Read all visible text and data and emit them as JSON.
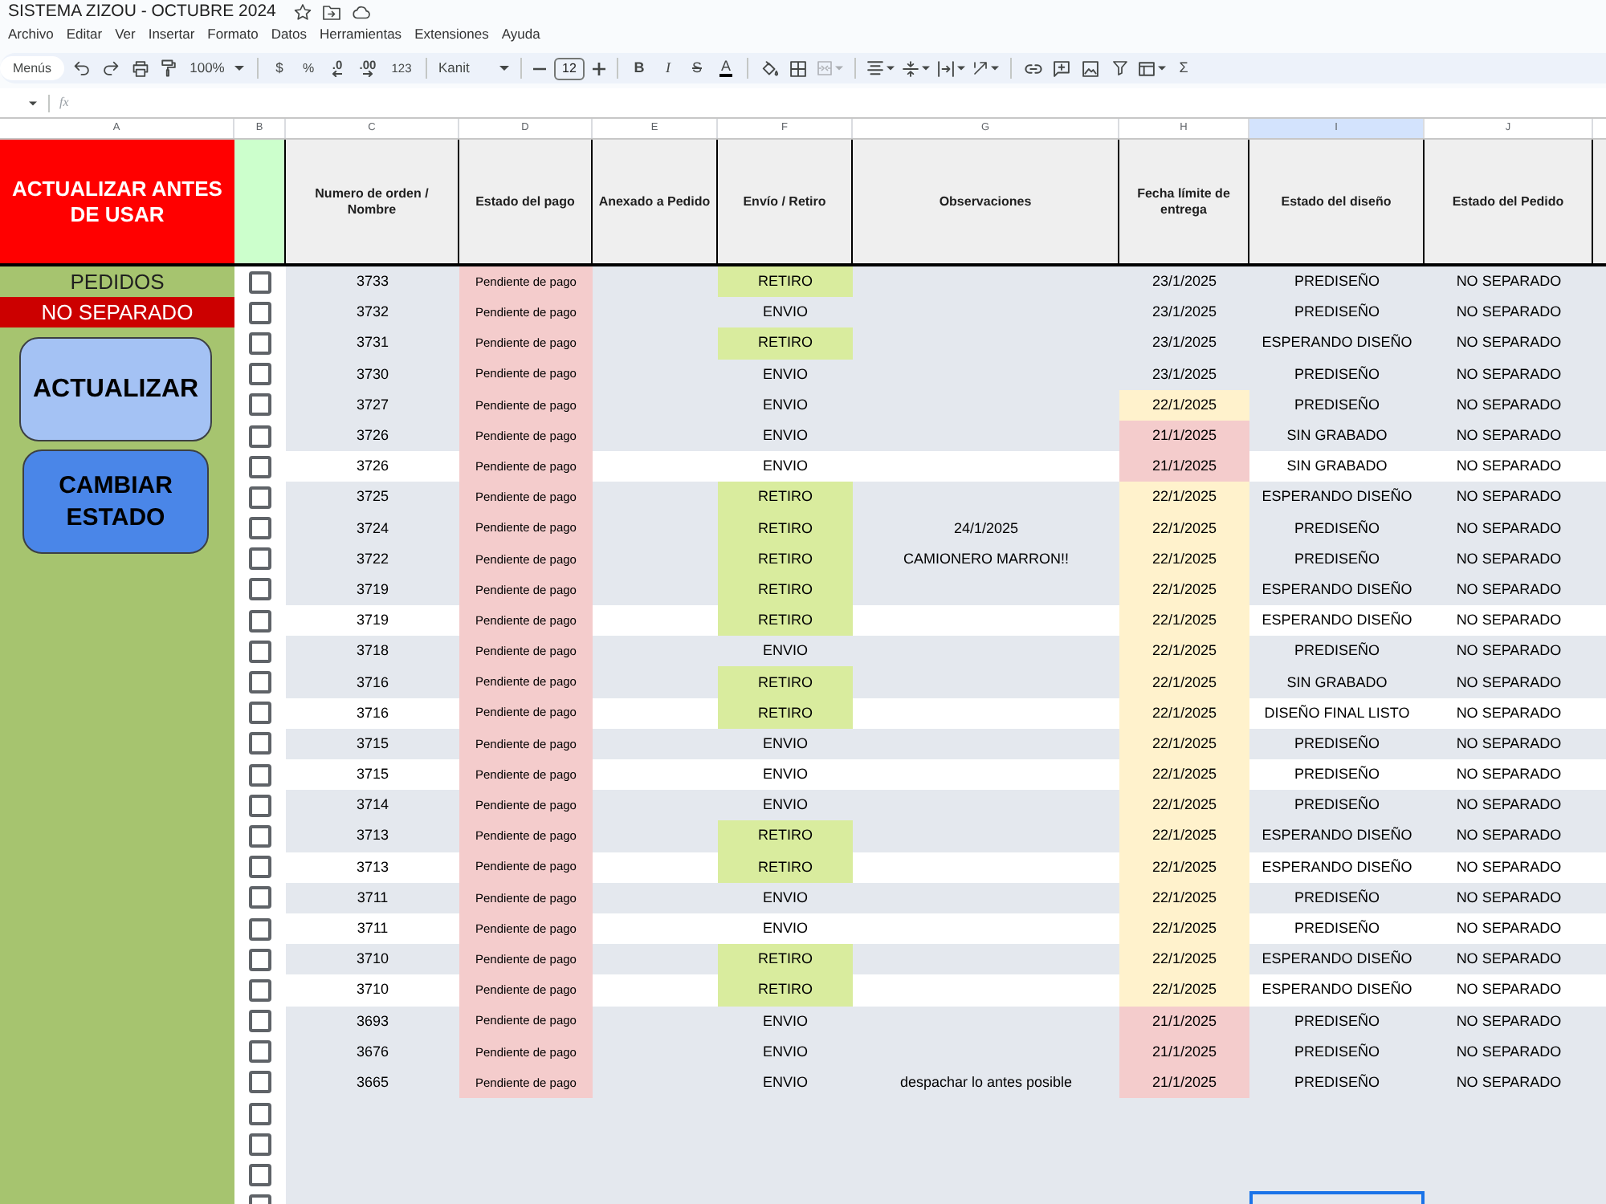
{
  "title": "SISTEMA ZIZOU - OCTUBRE 2024",
  "menu": [
    "Archivo",
    "Editar",
    "Ver",
    "Insertar",
    "Formato",
    "Datos",
    "Herramientas",
    "Extensiones",
    "Ayuda"
  ],
  "toolbar": {
    "menus": "Menús",
    "zoom": "100%",
    "currency": "$",
    "percent": "%",
    "decrease_decimals": ".0",
    "increase_decimals": ".00",
    "number_format": "123",
    "font": "Kanit",
    "font_size": "12",
    "bold": "B",
    "italic": "I",
    "strikethrough": "S",
    "text_color": "A",
    "functions": "Σ"
  },
  "formula_bar": {
    "label": "fx"
  },
  "columns": [
    {
      "letter": "A",
      "selected": false
    },
    {
      "letter": "B",
      "selected": false
    },
    {
      "letter": "C",
      "selected": false
    },
    {
      "letter": "D",
      "selected": false
    },
    {
      "letter": "E",
      "selected": false
    },
    {
      "letter": "F",
      "selected": false
    },
    {
      "letter": "G",
      "selected": false
    },
    {
      "letter": "H",
      "selected": false
    },
    {
      "letter": "I",
      "selected": true
    },
    {
      "letter": "J",
      "selected": false
    }
  ],
  "header": {
    "banner": "ACTUALIZAR ANTES DE USAR",
    "titles": [
      "Numero de orden / Nombre",
      "Estado del pago",
      "Anexado a Pedido",
      "Envío / Retiro",
      "Observaciones",
      "Fecha límite de entrega",
      "Estado del diseño",
      "Estado del Pedido"
    ]
  },
  "panel": {
    "title": "PEDIDOS",
    "filter": "NO SEPARADO",
    "buttons": [
      "ACTUALIZAR",
      "CAMBIAR ESTADO"
    ]
  },
  "rows": [
    {
      "checked": false,
      "selected": false,
      "shaded": true,
      "order": "3733",
      "payment": "Pendiente de pago",
      "delivery": {
        "text": "RETIRO",
        "color": "#d9ec9e"
      },
      "deadline": {
        "text": "23/1/2025"
      },
      "design": "PREDISEÑO",
      "status": "NO SEPARADO"
    },
    {
      "checked": false,
      "selected": false,
      "shaded": true,
      "order": "3732",
      "payment": "Pendiente de pago",
      "delivery": {
        "text": "ENVIO"
      },
      "deadline": {
        "text": "23/1/2025"
      },
      "design": "PREDISEÑO",
      "status": "NO SEPARADO"
    },
    {
      "checked": false,
      "selected": false,
      "shaded": true,
      "order": "3731",
      "payment": "Pendiente de pago",
      "delivery": {
        "text": "RETIRO",
        "color": "#d9ec9e"
      },
      "deadline": {
        "text": "23/1/2025"
      },
      "design": "ESPERANDO DISEÑO",
      "status": "NO SEPARADO"
    },
    {
      "checked": false,
      "selected": false,
      "shaded": true,
      "order": "3730",
      "payment": "Pendiente de pago",
      "delivery": {
        "text": "ENVIO"
      },
      "deadline": {
        "text": "23/1/2025"
      },
      "design": "PREDISEÑO",
      "status": "NO SEPARADO"
    },
    {
      "checked": false,
      "selected": false,
      "shaded": true,
      "order": "3727",
      "payment": "Pendiente de pago",
      "delivery": {
        "text": "ENVIO"
      },
      "deadline": {
        "text": "22/1/2025",
        "color": "#fff2cc"
      },
      "design": "PREDISEÑO",
      "status": "NO SEPARADO"
    },
    {
      "checked": false,
      "selected": false,
      "shaded": true,
      "order": "3726",
      "payment": "Pendiente de pago",
      "delivery": {
        "text": "ENVIO"
      },
      "deadline": {
        "text": "21/1/2025",
        "color": "#f4cccc"
      },
      "design": "SIN GRABADO",
      "status": "NO SEPARADO"
    },
    {
      "checked": false,
      "selected": false,
      "shaded": false,
      "order": "3726",
      "payment": "Pendiente de pago",
      "delivery": {
        "text": "ENVIO"
      },
      "deadline": {
        "text": "21/1/2025",
        "color": "#f4cccc"
      },
      "design": "SIN GRABADO",
      "status": "NO SEPARADO"
    },
    {
      "checked": false,
      "selected": false,
      "shaded": true,
      "order": "3725",
      "payment": "Pendiente de pago",
      "delivery": {
        "text": "RETIRO",
        "color": "#d9ec9e"
      },
      "deadline": {
        "text": "22/1/2025",
        "color": "#fff2cc"
      },
      "design": "ESPERANDO DISEÑO",
      "status": "NO SEPARADO"
    },
    {
      "checked": false,
      "selected": false,
      "shaded": true,
      "order": "3724",
      "payment": "Pendiente de pago",
      "delivery": {
        "text": "RETIRO",
        "color": "#d9ec9e"
      },
      "notes": "24/1/2025",
      "deadline": {
        "text": "22/1/2025",
        "color": "#fff2cc"
      },
      "design": "PREDISEÑO",
      "status": "NO SEPARADO"
    },
    {
      "checked": false,
      "selected": false,
      "shaded": true,
      "order": "3722",
      "payment": "Pendiente de pago",
      "delivery": {
        "text": "RETIRO",
        "color": "#d9ec9e"
      },
      "notes": "CAMIONERO MARRON!!",
      "deadline": {
        "text": "22/1/2025",
        "color": "#fff2cc"
      },
      "design": "PREDISEÑO",
      "status": "NO SEPARADO"
    },
    {
      "checked": false,
      "selected": false,
      "shaded": true,
      "order": "3719",
      "payment": "Pendiente de pago",
      "delivery": {
        "text": "RETIRO",
        "color": "#d9ec9e"
      },
      "deadline": {
        "text": "22/1/2025",
        "color": "#fff2cc"
      },
      "design": "ESPERANDO DISEÑO",
      "status": "NO SEPARADO"
    },
    {
      "checked": false,
      "selected": false,
      "shaded": false,
      "order": "3719",
      "payment": "Pendiente de pago",
      "delivery": {
        "text": "RETIRO",
        "color": "#d9ec9e"
      },
      "deadline": {
        "text": "22/1/2025",
        "color": "#fff2cc"
      },
      "design": "ESPERANDO DISEÑO",
      "status": "NO SEPARADO"
    },
    {
      "checked": false,
      "selected": false,
      "shaded": true,
      "order": "3718",
      "payment": "Pendiente de pago",
      "delivery": {
        "text": "ENVIO"
      },
      "deadline": {
        "text": "22/1/2025",
        "color": "#fff2cc"
      },
      "design": "PREDISEÑO",
      "status": "NO SEPARADO"
    },
    {
      "checked": false,
      "selected": false,
      "shaded": true,
      "order": "3716",
      "payment": "Pendiente de pago",
      "delivery": {
        "text": "RETIRO",
        "color": "#d9ec9e"
      },
      "deadline": {
        "text": "22/1/2025",
        "color": "#fff2cc"
      },
      "design": "SIN GRABADO",
      "status": "NO SEPARADO"
    },
    {
      "checked": false,
      "selected": false,
      "shaded": false,
      "order": "3716",
      "payment": "Pendiente de pago",
      "delivery": {
        "text": "RETIRO",
        "color": "#d9ec9e"
      },
      "deadline": {
        "text": "22/1/2025",
        "color": "#fff2cc"
      },
      "design": "DISEÑO FINAL LISTO",
      "status": "NO SEPARADO"
    },
    {
      "checked": false,
      "selected": false,
      "shaded": true,
      "order": "3715",
      "payment": "Pendiente de pago",
      "delivery": {
        "text": "ENVIO"
      },
      "deadline": {
        "text": "22/1/2025",
        "color": "#fff2cc"
      },
      "design": "PREDISEÑO",
      "status": "NO SEPARADO"
    },
    {
      "checked": false,
      "selected": false,
      "shaded": false,
      "order": "3715",
      "payment": "Pendiente de pago",
      "delivery": {
        "text": "ENVIO"
      },
      "deadline": {
        "text": "22/1/2025",
        "color": "#fff2cc"
      },
      "design": "PREDISEÑO",
      "status": "NO SEPARADO"
    },
    {
      "checked": false,
      "selected": false,
      "shaded": true,
      "order": "3714",
      "payment": "Pendiente de pago",
      "delivery": {
        "text": "ENVIO"
      },
      "deadline": {
        "text": "22/1/2025",
        "color": "#fff2cc"
      },
      "design": "PREDISEÑO",
      "status": "NO SEPARADO"
    },
    {
      "checked": false,
      "selected": false,
      "shaded": true,
      "order": "3713",
      "payment": "Pendiente de pago",
      "delivery": {
        "text": "RETIRO",
        "color": "#d9ec9e"
      },
      "deadline": {
        "text": "22/1/2025",
        "color": "#fff2cc"
      },
      "design": "ESPERANDO DISEÑO",
      "status": "NO SEPARADO"
    },
    {
      "checked": false,
      "selected": false,
      "shaded": false,
      "order": "3713",
      "payment": "Pendiente de pago",
      "delivery": {
        "text": "RETIRO",
        "color": "#d9ec9e"
      },
      "deadline": {
        "text": "22/1/2025",
        "color": "#fff2cc"
      },
      "design": "ESPERANDO DISEÑO",
      "status": "NO SEPARADO"
    },
    {
      "checked": false,
      "selected": false,
      "shaded": true,
      "order": "3711",
      "payment": "Pendiente de pago",
      "delivery": {
        "text": "ENVIO"
      },
      "deadline": {
        "text": "22/1/2025",
        "color": "#fff2cc"
      },
      "design": "PREDISEÑO",
      "status": "NO SEPARADO"
    },
    {
      "checked": false,
      "selected": false,
      "shaded": false,
      "order": "3711",
      "payment": "Pendiente de pago",
      "delivery": {
        "text": "ENVIO"
      },
      "deadline": {
        "text": "22/1/2025",
        "color": "#fff2cc"
      },
      "design": "PREDISEÑO",
      "status": "NO SEPARADO"
    },
    {
      "checked": false,
      "selected": false,
      "shaded": true,
      "order": "3710",
      "payment": "Pendiente de pago",
      "delivery": {
        "text": "RETIRO",
        "color": "#d9ec9e"
      },
      "deadline": {
        "text": "22/1/2025",
        "color": "#fff2cc"
      },
      "design": "ESPERANDO DISEÑO",
      "status": "NO SEPARADO"
    },
    {
      "checked": false,
      "selected": false,
      "shaded": false,
      "order": "3710",
      "payment": "Pendiente de pago",
      "delivery": {
        "text": "RETIRO",
        "color": "#d9ec9e"
      },
      "deadline": {
        "text": "22/1/2025",
        "color": "#fff2cc"
      },
      "design": "ESPERANDO DISEÑO",
      "status": "NO SEPARADO"
    },
    {
      "checked": false,
      "selected": false,
      "shaded": true,
      "order": "3693",
      "payment": "Pendiente de pago",
      "delivery": {
        "text": "ENVIO"
      },
      "deadline": {
        "text": "21/1/2025",
        "color": "#f4cccc"
      },
      "design": "PREDISEÑO",
      "status": "NO SEPARADO"
    },
    {
      "checked": false,
      "selected": false,
      "shaded": true,
      "order": "3676",
      "payment": "Pendiente de pago",
      "delivery": {
        "text": "ENVIO"
      },
      "deadline": {
        "text": "21/1/2025",
        "color": "#f4cccc"
      },
      "design": "PREDISEÑO",
      "status": "NO SEPARADO"
    },
    {
      "checked": false,
      "selected": false,
      "shaded": true,
      "order": "3665",
      "payment": "Pendiente de pago",
      "delivery": {
        "text": "ENVIO"
      },
      "notes": "despachar lo antes posible",
      "deadline": {
        "text": "21/1/2025",
        "color": "#f4cccc"
      },
      "design": "PREDISEÑO",
      "status": "NO SEPARADO"
    },
    {
      "checked": false,
      "selected": false,
      "shaded": true
    },
    {
      "checked": false,
      "selected": false,
      "shaded": true
    },
    {
      "checked": false,
      "selected": false,
      "shaded": true
    },
    {
      "checked": false,
      "selected": true,
      "shaded": true
    }
  ]
}
